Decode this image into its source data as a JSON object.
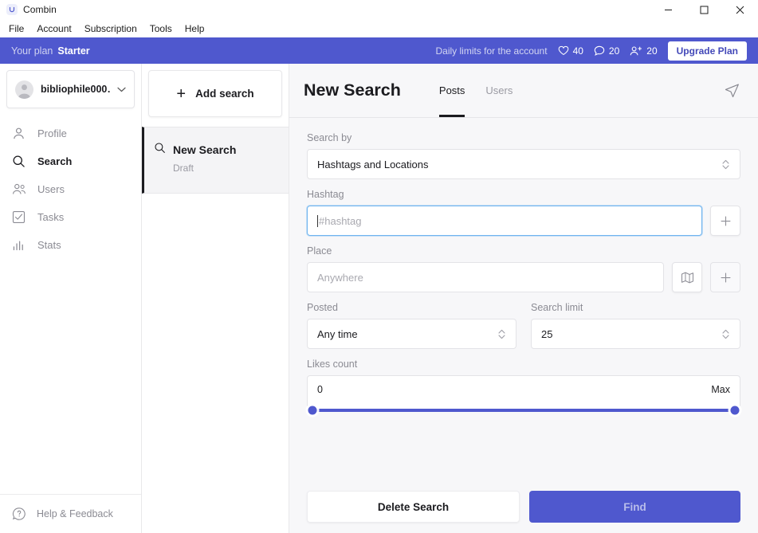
{
  "window": {
    "title": "Combin",
    "logo_icon": "combin-logo-icon",
    "controls": {
      "minimize": "minimize-icon",
      "maximize": "maximize-icon",
      "close": "close-icon"
    }
  },
  "menubar": {
    "items": [
      {
        "label": "File"
      },
      {
        "label": "Account"
      },
      {
        "label": "Subscription"
      },
      {
        "label": "Tools"
      },
      {
        "label": "Help"
      }
    ]
  },
  "planbar": {
    "plan_label": "Your plan",
    "plan_name": "Starter",
    "limits_label": "Daily limits for the account",
    "limits": [
      {
        "icon": "heart-icon",
        "value": "40"
      },
      {
        "icon": "comment-icon",
        "value": "20"
      },
      {
        "icon": "follow-user-icon",
        "value": "20"
      }
    ],
    "upgrade_label": "Upgrade Plan",
    "accent": "#4F58CE"
  },
  "sidebar": {
    "account": {
      "name": "bibliophile000…",
      "avatar_icon": "avatar-icon",
      "chevron_icon": "chevron-down-icon"
    },
    "items": [
      {
        "label": "Profile",
        "icon": "profile-icon",
        "active": false
      },
      {
        "label": "Search",
        "icon": "search-icon",
        "active": true
      },
      {
        "label": "Users",
        "icon": "users-icon",
        "active": false
      },
      {
        "label": "Tasks",
        "icon": "tasks-icon",
        "active": false
      },
      {
        "label": "Stats",
        "icon": "stats-icon",
        "active": false
      }
    ],
    "footer": {
      "label": "Help & Feedback",
      "icon": "help-icon"
    }
  },
  "searchlist": {
    "add_label": "Add search",
    "add_icon": "plus-icon",
    "items": [
      {
        "title": "New Search",
        "status": "Draft",
        "icon": "search-icon",
        "selected": true
      }
    ]
  },
  "main": {
    "title": "New Search",
    "tabs": [
      {
        "label": "Posts",
        "active": true
      },
      {
        "label": "Users",
        "active": false
      }
    ],
    "send_icon": "send-icon",
    "form": {
      "search_by": {
        "label": "Search by",
        "value": "Hashtags and Locations"
      },
      "hashtag": {
        "label": "Hashtag",
        "value": "",
        "placeholder": "#hashtag",
        "focused": true,
        "add_icon": "plus-icon"
      },
      "place": {
        "label": "Place",
        "value": "",
        "placeholder": "Anywhere",
        "map_icon": "map-icon",
        "add_icon": "plus-icon"
      },
      "posted": {
        "label": "Posted",
        "value": "Any time"
      },
      "search_limit": {
        "label": "Search limit",
        "value": "25"
      },
      "likes_count": {
        "label": "Likes count",
        "min_label": "0",
        "max_label": "Max",
        "track_color": "#4F58CE"
      }
    },
    "actions": {
      "delete_label": "Delete Search",
      "find_label": "Find"
    }
  }
}
